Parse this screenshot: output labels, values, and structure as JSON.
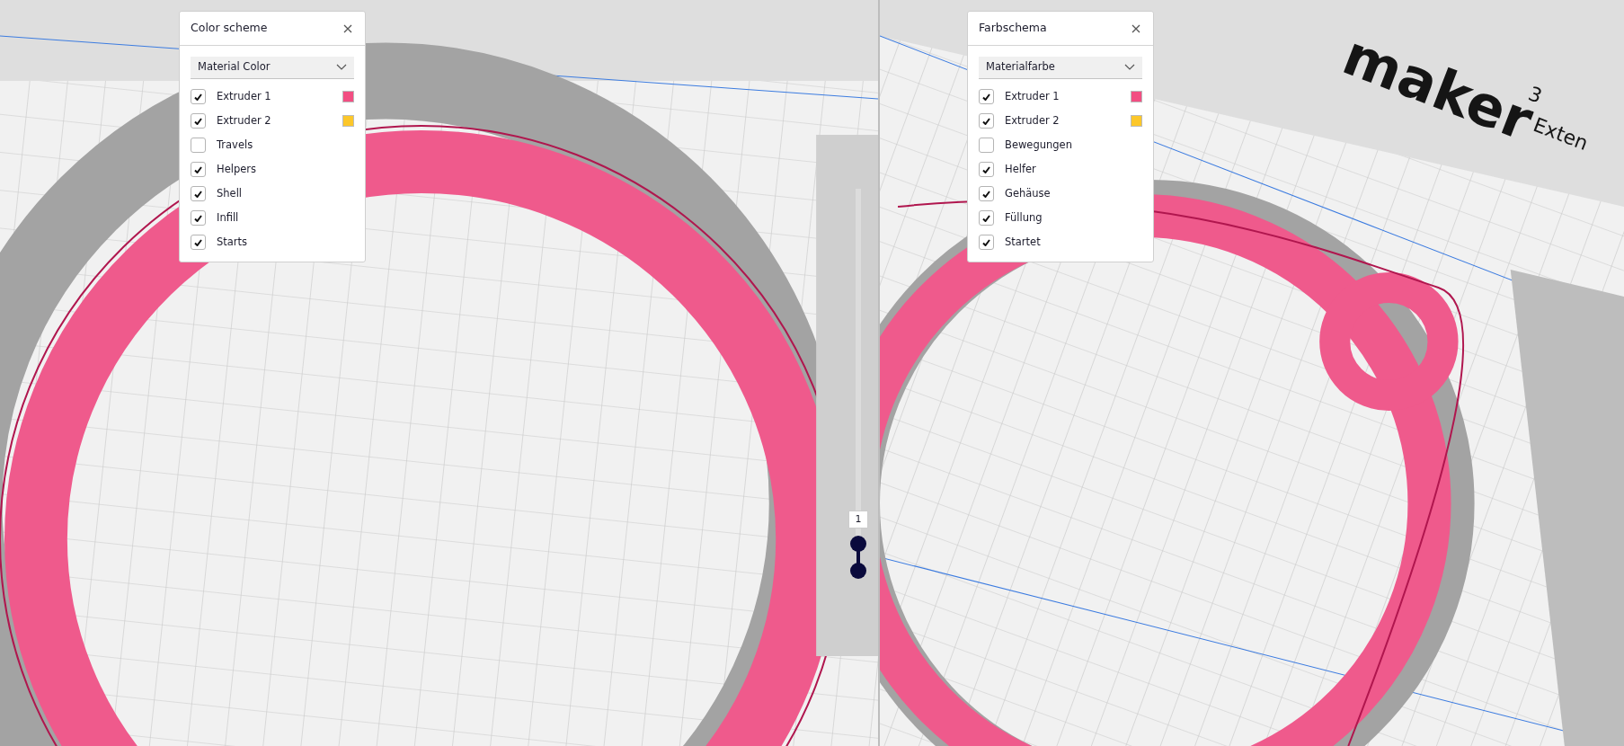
{
  "viewports": [
    {
      "panel": {
        "title": "Color scheme",
        "dropdown": "Material Color",
        "items": [
          {
            "label": "Extruder 1",
            "checked": true,
            "color": "#f24e82"
          },
          {
            "label": "Extruder 2",
            "checked": true,
            "color": "#fcc72a"
          },
          {
            "label": "Travels",
            "checked": false
          },
          {
            "label": "Helpers",
            "checked": true
          },
          {
            "label": "Shell",
            "checked": true
          },
          {
            "label": "Infill",
            "checked": true
          },
          {
            "label": "Starts",
            "checked": true
          }
        ]
      },
      "layer_slider": {
        "label": "1"
      }
    },
    {
      "panel": {
        "title": "Farbschema",
        "dropdown": "Materialfarbe",
        "items": [
          {
            "label": "Extruder 1",
            "checked": true,
            "color": "#f24e82"
          },
          {
            "label": "Extruder 2",
            "checked": true,
            "color": "#fcc72a"
          },
          {
            "label": "Bewegungen",
            "checked": false
          },
          {
            "label": "Helfer",
            "checked": true
          },
          {
            "label": "Gehäuse",
            "checked": true
          },
          {
            "label": "Füllung",
            "checked": true
          },
          {
            "label": "Startet",
            "checked": true
          }
        ]
      },
      "printer_label": {
        "name": "maker",
        "version": "3",
        "variant": "Exten"
      }
    }
  ]
}
